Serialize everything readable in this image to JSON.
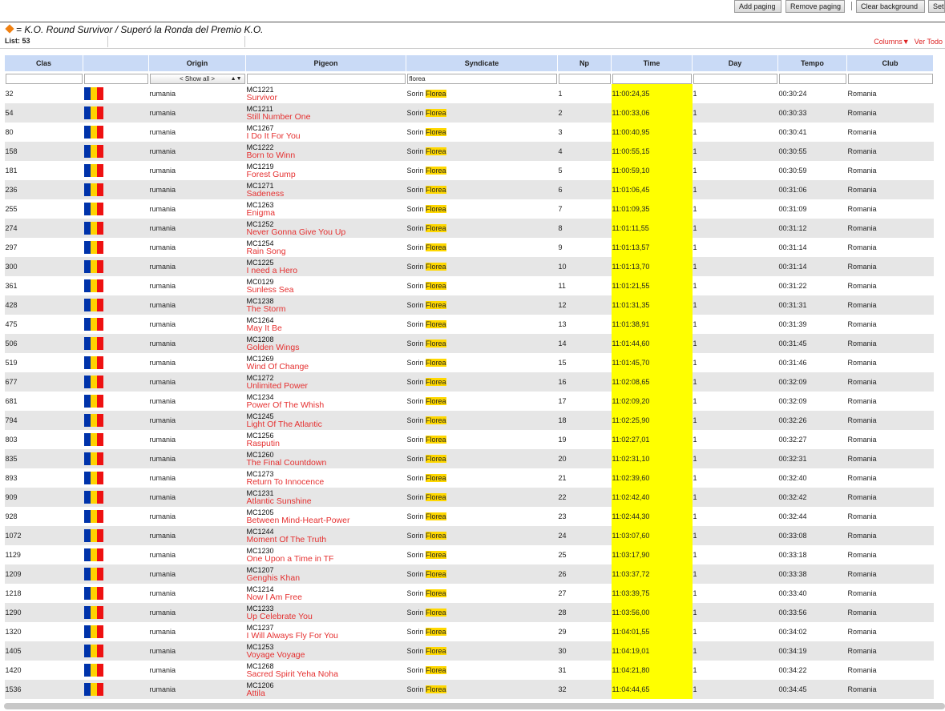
{
  "toolbar": {
    "buttons": [
      "Add paging",
      "Remove paging",
      "Clear background",
      "Set"
    ]
  },
  "title": "= K.O. Round Survivor / Superó la Ronda del Premio K.O.",
  "list_label": "List: 53",
  "links": {
    "columns": "Columns▼",
    "ver_todo": "Ver Todo"
  },
  "columns": [
    "Clas",
    "",
    "Origin",
    "Pigeon",
    "Syndicate",
    "Np",
    "Time",
    "Day",
    "Tempo",
    "Club"
  ],
  "filters": {
    "origin": "< Show all >",
    "syndicate": "florea"
  },
  "syndicate_prefix": "Sorin ",
  "syndicate_highlight": "Florea",
  "origin": "rumania",
  "club": "Romania",
  "rows": [
    {
      "clas": "32",
      "pid": "MC1221",
      "name": "Survivor",
      "np": "1",
      "time": "11:00:24,35",
      "day": "1",
      "tempo": "00:30:24"
    },
    {
      "clas": "54",
      "pid": "MC1211",
      "name": "Still Number One",
      "np": "2",
      "time": "11:00:33,06",
      "day": "1",
      "tempo": "00:30:33"
    },
    {
      "clas": "80",
      "pid": "MC1267",
      "name": "I Do It For You",
      "np": "3",
      "time": "11:00:40,95",
      "day": "1",
      "tempo": "00:30:41"
    },
    {
      "clas": "158",
      "pid": "MC1222",
      "name": "Born to Winn",
      "np": "4",
      "time": "11:00:55,15",
      "day": "1",
      "tempo": "00:30:55"
    },
    {
      "clas": "181",
      "pid": "MC1219",
      "name": "Forest Gump",
      "np": "5",
      "time": "11:00:59,10",
      "day": "1",
      "tempo": "00:30:59"
    },
    {
      "clas": "236",
      "pid": "MC1271",
      "name": "Sadeness",
      "np": "6",
      "time": "11:01:06,45",
      "day": "1",
      "tempo": "00:31:06"
    },
    {
      "clas": "255",
      "pid": "MC1263",
      "name": "Enigma",
      "np": "7",
      "time": "11:01:09,35",
      "day": "1",
      "tempo": "00:31:09"
    },
    {
      "clas": "274",
      "pid": "MC1252",
      "name": "Never Gonna Give You Up",
      "np": "8",
      "time": "11:01:11,55",
      "day": "1",
      "tempo": "00:31:12"
    },
    {
      "clas": "297",
      "pid": "MC1254",
      "name": "Rain Song",
      "np": "9",
      "time": "11:01:13,57",
      "day": "1",
      "tempo": "00:31:14"
    },
    {
      "clas": "300",
      "pid": "MC1225",
      "name": "I need a Hero",
      "np": "10",
      "time": "11:01:13,70",
      "day": "1",
      "tempo": "00:31:14"
    },
    {
      "clas": "361",
      "pid": "MC0129",
      "name": "Sunless Sea",
      "np": "11",
      "time": "11:01:21,55",
      "day": "1",
      "tempo": "00:31:22"
    },
    {
      "clas": "428",
      "pid": "MC1238",
      "name": "The Storm",
      "np": "12",
      "time": "11:01:31,35",
      "day": "1",
      "tempo": "00:31:31"
    },
    {
      "clas": "475",
      "pid": "MC1264",
      "name": "May It Be",
      "np": "13",
      "time": "11:01:38,91",
      "day": "1",
      "tempo": "00:31:39"
    },
    {
      "clas": "506",
      "pid": "MC1208",
      "name": "Golden Wings",
      "np": "14",
      "time": "11:01:44,60",
      "day": "1",
      "tempo": "00:31:45"
    },
    {
      "clas": "519",
      "pid": "MC1269",
      "name": "Wind Of Change",
      "np": "15",
      "time": "11:01:45,70",
      "day": "1",
      "tempo": "00:31:46"
    },
    {
      "clas": "677",
      "pid": "MC1272",
      "name": "Unlimited Power",
      "np": "16",
      "time": "11:02:08,65",
      "day": "1",
      "tempo": "00:32:09"
    },
    {
      "clas": "681",
      "pid": "MC1234",
      "name": "Power Of The Whish",
      "np": "17",
      "time": "11:02:09,20",
      "day": "1",
      "tempo": "00:32:09"
    },
    {
      "clas": "794",
      "pid": "MC1245",
      "name": "Light Of The Atlantic",
      "np": "18",
      "time": "11:02:25,90",
      "day": "1",
      "tempo": "00:32:26"
    },
    {
      "clas": "803",
      "pid": "MC1256",
      "name": "Rasputin",
      "np": "19",
      "time": "11:02:27,01",
      "day": "1",
      "tempo": "00:32:27"
    },
    {
      "clas": "835",
      "pid": "MC1260",
      "name": "The Final Countdown",
      "np": "20",
      "time": "11:02:31,10",
      "day": "1",
      "tempo": "00:32:31"
    },
    {
      "clas": "893",
      "pid": "MC1273",
      "name": "Return To Innocence",
      "np": "21",
      "time": "11:02:39,60",
      "day": "1",
      "tempo": "00:32:40"
    },
    {
      "clas": "909",
      "pid": "MC1231",
      "name": "Atlantic Sunshine",
      "np": "22",
      "time": "11:02:42,40",
      "day": "1",
      "tempo": "00:32:42"
    },
    {
      "clas": "928",
      "pid": "MC1205",
      "name": "Between Mind-Heart-Power",
      "np": "23",
      "time": "11:02:44,30",
      "day": "1",
      "tempo": "00:32:44"
    },
    {
      "clas": "1072",
      "pid": "MC1244",
      "name": "Moment Of The Truth",
      "np": "24",
      "time": "11:03:07,60",
      "day": "1",
      "tempo": "00:33:08"
    },
    {
      "clas": "1129",
      "pid": "MC1230",
      "name": "One Upon a Time in TF",
      "np": "25",
      "time": "11:03:17,90",
      "day": "1",
      "tempo": "00:33:18"
    },
    {
      "clas": "1209",
      "pid": "MC1207",
      "name": "Genghis Khan",
      "np": "26",
      "time": "11:03:37,72",
      "day": "1",
      "tempo": "00:33:38"
    },
    {
      "clas": "1218",
      "pid": "MC1214",
      "name": "Now I Am Free",
      "np": "27",
      "time": "11:03:39,75",
      "day": "1",
      "tempo": "00:33:40"
    },
    {
      "clas": "1290",
      "pid": "MC1233",
      "name": "Up Celebrate You",
      "np": "28",
      "time": "11:03:56,00",
      "day": "1",
      "tempo": "00:33:56"
    },
    {
      "clas": "1320",
      "pid": "MC1237",
      "name": "I Will Always Fly For You",
      "np": "29",
      "time": "11:04:01,55",
      "day": "1",
      "tempo": "00:34:02"
    },
    {
      "clas": "1405",
      "pid": "MC1253",
      "name": "Voyage Voyage",
      "np": "30",
      "time": "11:04:19,01",
      "day": "1",
      "tempo": "00:34:19"
    },
    {
      "clas": "1420",
      "pid": "MC1268",
      "name": "Sacred Spirit Yeha Noha",
      "np": "31",
      "time": "11:04:21,80",
      "day": "1",
      "tempo": "00:34:22"
    },
    {
      "clas": "1536",
      "pid": "MC1206",
      "name": "Attila",
      "np": "32",
      "time": "11:04:44,65",
      "day": "1",
      "tempo": "00:34:45"
    }
  ]
}
